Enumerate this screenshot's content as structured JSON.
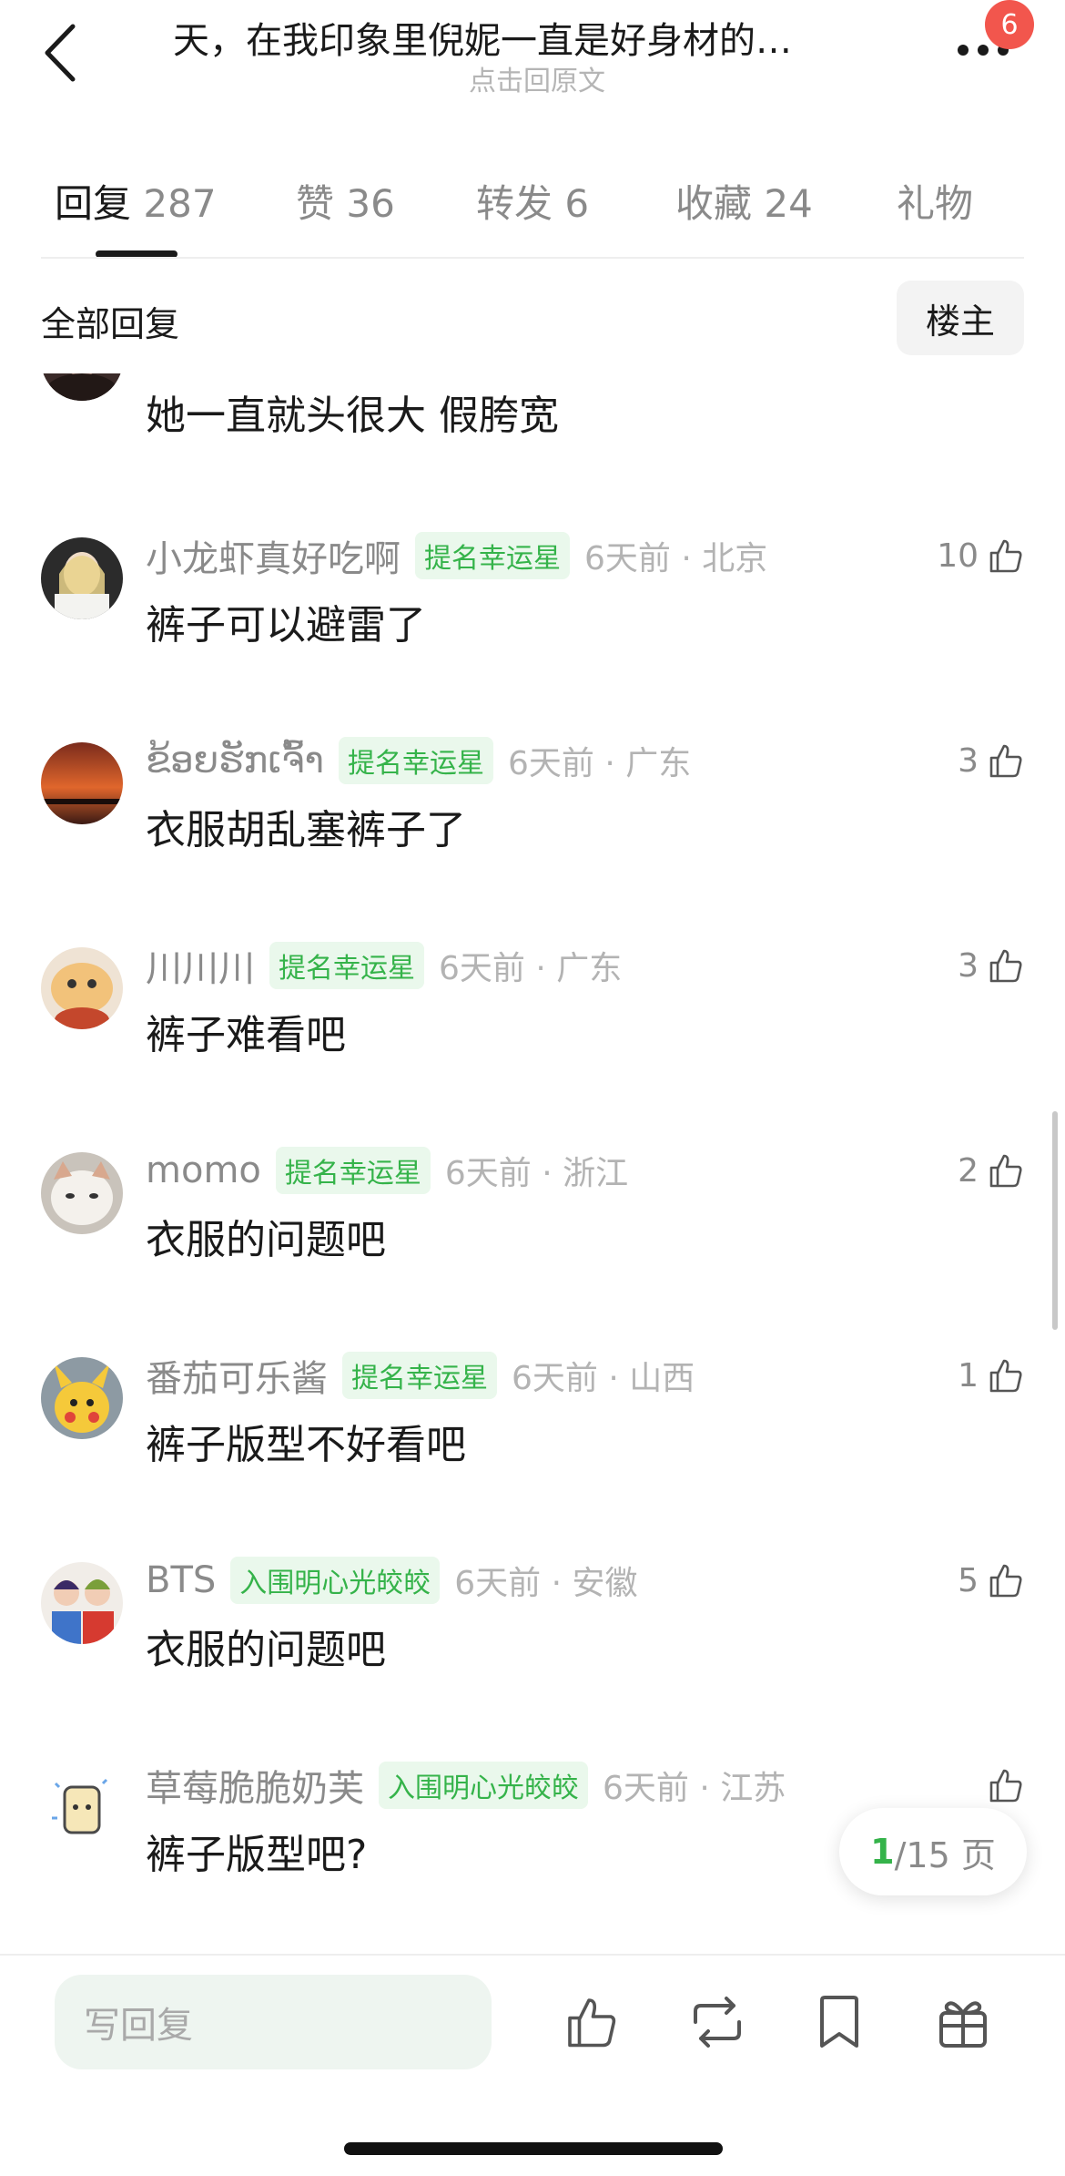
{
  "header": {
    "title": "天，在我印象里倪妮一直是好身材的…",
    "subtitle": "点击回原文",
    "badge_count": "6"
  },
  "tabs": [
    {
      "label": "回复",
      "count": "287",
      "active": true
    },
    {
      "label": "赞",
      "count": "36"
    },
    {
      "label": "转发",
      "count": "6"
    },
    {
      "label": "收藏",
      "count": "24"
    },
    {
      "label": "礼物",
      "count": ""
    }
  ],
  "filter": {
    "all_replies": "全部回复",
    "op_only": "楼主"
  },
  "comments": [
    {
      "username": "",
      "tag": "",
      "time": "",
      "text": "她一直就头很大 假胯宽",
      "likes": ""
    },
    {
      "username": "小龙虾真好吃啊",
      "tag": "提名幸运星",
      "time": "6天前 · 北京",
      "text": "裤子可以避雷了",
      "likes": "10"
    },
    {
      "username": "ຂ້ອຍຮັກເຈົ້າ",
      "tag": "提名幸运星",
      "time": "6天前 · 广东",
      "text": "衣服胡乱塞裤子了",
      "likes": "3"
    },
    {
      "username": "川川川",
      "tag": "提名幸运星",
      "time": "6天前 · 广东",
      "text": "裤子难看吧",
      "likes": "3"
    },
    {
      "username": "momo",
      "tag": "提名幸运星",
      "time": "6天前 · 浙江",
      "text": "衣服的问题吧",
      "likes": "2"
    },
    {
      "username": "番茄可乐酱",
      "tag": "提名幸运星",
      "time": "6天前 · 山西",
      "text": "裤子版型不好看吧",
      "likes": "1"
    },
    {
      "username": "BTS",
      "tag": "入围明心光皎皎",
      "time": "6天前 · 安徽",
      "text": "衣服的问题吧",
      "likes": "5"
    },
    {
      "username": "草莓脆脆奶芙",
      "tag": "入围明心光皎皎",
      "time": "6天前 · 江苏",
      "text": "裤子版型吧?",
      "likes": ""
    }
  ],
  "pager": {
    "current": "1",
    "total_text": "/15 页"
  },
  "bottom_bar": {
    "reply_placeholder": "写回复"
  },
  "colors": {
    "accent_green": "#35b34a",
    "badge_red": "#f2564d"
  }
}
